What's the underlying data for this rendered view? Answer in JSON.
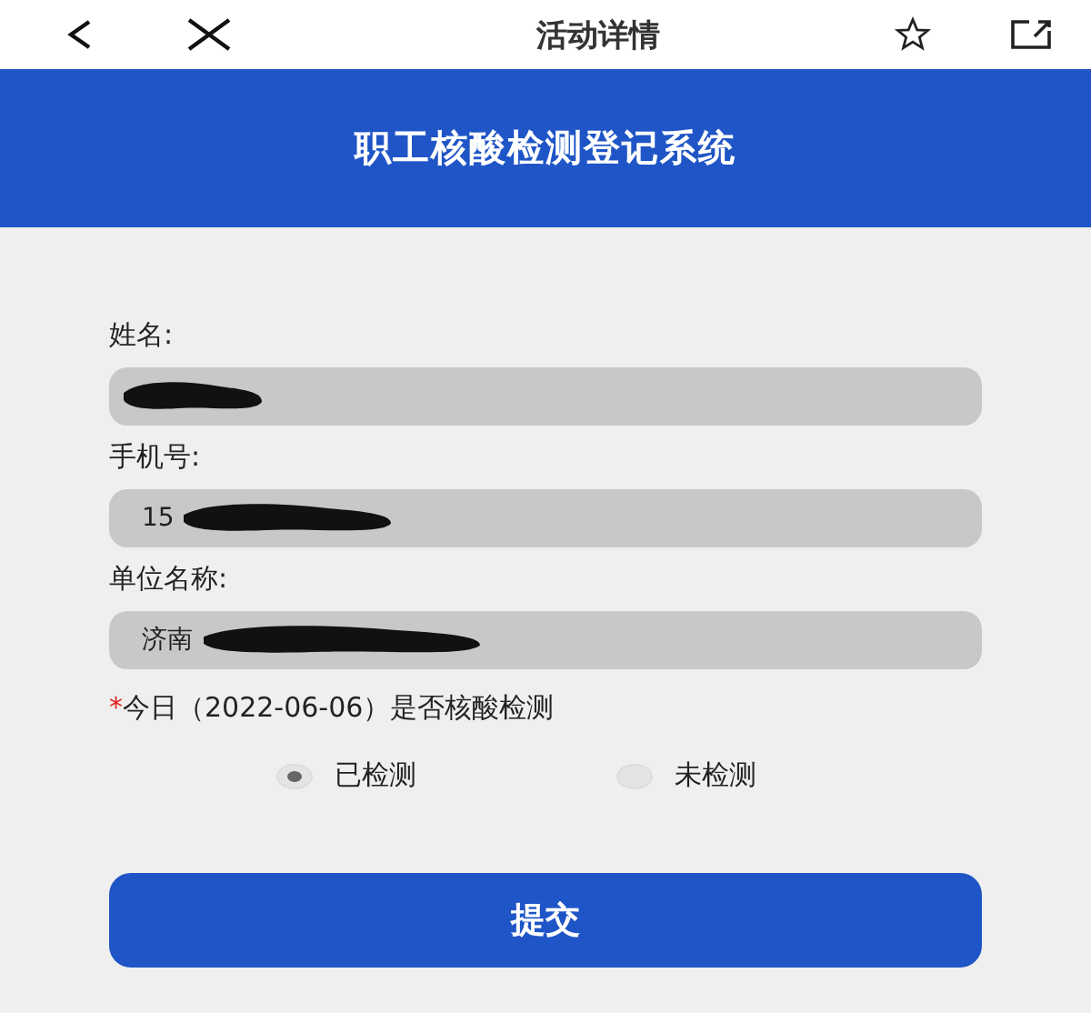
{
  "top_bar": {
    "title": "活动详情"
  },
  "header": {
    "title": "职工核酸检测登记系统"
  },
  "fields": [
    {
      "label": "姓名:",
      "redacted": true
    },
    {
      "label": "手机号:",
      "value": "15",
      "redacted": true
    },
    {
      "label": "单位名称:",
      "value": "济南",
      "redacted": true
    }
  ],
  "question": {
    "required_mark": "*",
    "text": "今日（2022-06-06）是否核酸检测"
  },
  "options": [
    {
      "label": "已检测",
      "selected": true
    },
    {
      "label": "未检测",
      "selected": false
    }
  ],
  "submit_button": "提交"
}
